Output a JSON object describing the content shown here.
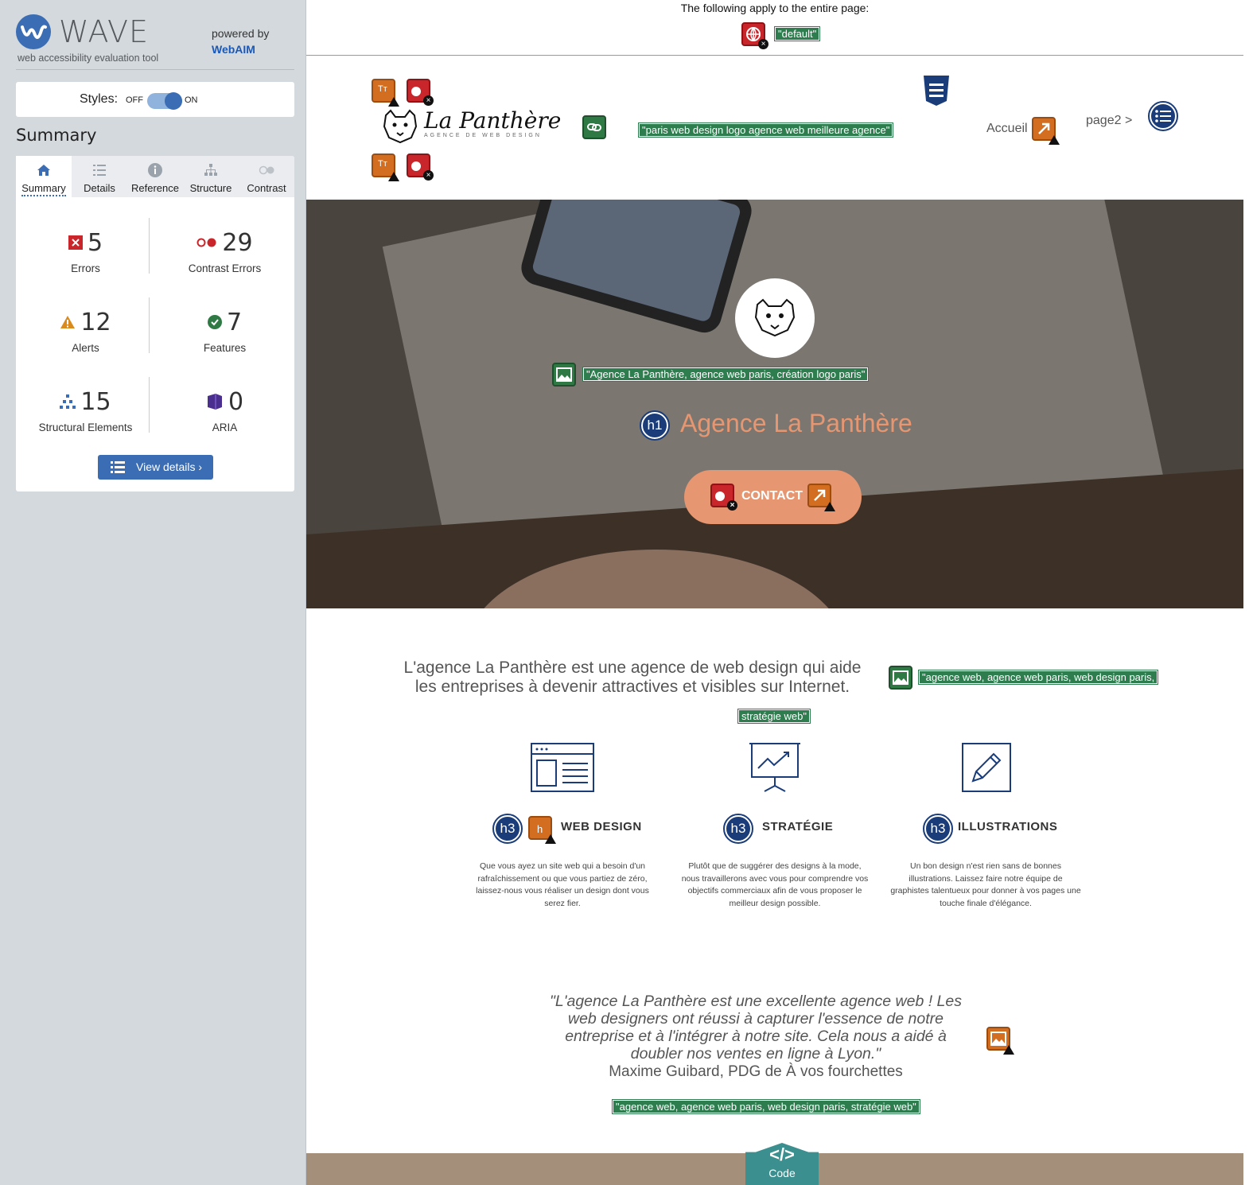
{
  "wave": {
    "name": "WAVE",
    "tagline": "web accessibility evaluation tool",
    "powered_by": "powered by",
    "powered_by_org": "WebAIM",
    "styles_label": "Styles:",
    "styles_off": "OFF",
    "styles_on": "ON",
    "styles_enabled": true,
    "summary_heading": "Summary",
    "tabs": [
      {
        "label": "Summary",
        "icon": "home-icon",
        "active": true
      },
      {
        "label": "Details",
        "icon": "list-icon",
        "active": false
      },
      {
        "label": "Reference",
        "icon": "info-icon",
        "active": false
      },
      {
        "label": "Structure",
        "icon": "structure-icon",
        "active": false
      },
      {
        "label": "Contrast",
        "icon": "contrast-icon",
        "active": false
      }
    ],
    "stats": {
      "errors": {
        "value": "5",
        "label": "Errors",
        "icon": "error-icon",
        "color": "#c8262a"
      },
      "contrast": {
        "value": "29",
        "label": "Contrast Errors",
        "icon": "contrast-error-icon",
        "color": "#c8262a"
      },
      "alerts": {
        "value": "12",
        "label": "Alerts",
        "icon": "alert-icon",
        "color": "#d98b1e"
      },
      "features": {
        "value": "7",
        "label": "Features",
        "icon": "feature-icon",
        "color": "#2f7a44"
      },
      "structural": {
        "value": "15",
        "label": "Structural Elements",
        "icon": "structure-icon",
        "color": "#3a6db3"
      },
      "aria": {
        "value": "0",
        "label": "ARIA",
        "icon": "aria-icon",
        "color": "#4a2f8f"
      }
    },
    "view_details": "View details ›"
  },
  "page": {
    "notice": "The following apply to the entire page:",
    "lang_tag": "\"default\"",
    "logo_title": "La Panthère",
    "logo_subtitle": "AGENCE DE WEB DESIGN",
    "logo_alt_tag": "\"paris web design logo agence web meilleure agence\"",
    "nav": {
      "home": "Accueil",
      "page2": "page2 >"
    },
    "hero_alt_tag": "\"Agence La Panthère, agence web paris, création logo paris\"",
    "hero_heading_level": "h1",
    "hero_title": "Agence La Panthère",
    "contact_label": "CONTACT",
    "intro_line1": "L'agence La Panthère est une agence de web design qui aide",
    "intro_line2": "les entreprises à devenir attractives et visibles sur Internet.",
    "intro_alt_tag_1": "\"agence web, agence web paris, web design paris,",
    "intro_alt_tag_2": "stratégie web\"",
    "services": [
      {
        "heading_level": "h3",
        "title": "WEB DESIGN",
        "icon": "browser-window-icon",
        "desc": "Que vous ayez un site web qui a besoin d'un rafraîchissement ou que vous partiez de zéro, laissez-nous vous réaliser un design dont vous serez fier."
      },
      {
        "heading_level": "h3",
        "title": "STRATÉGIE",
        "icon": "chart-board-icon",
        "desc": "Plutôt que de suggérer des designs à la mode, nous travaillerons avec vous pour comprendre vos objectifs commerciaux afin de vous proposer le meilleur design possible."
      },
      {
        "heading_level": "h3",
        "title": "ILLUSTRATIONS",
        "icon": "pencil-box-icon",
        "desc": "Un bon design n'est rien sans de bonnes illustrations. Laissez faire notre équipe de graphistes talentueux pour donner à vos pages une touche finale d'élégance."
      }
    ],
    "quote_line1": "\"L'agence La Panthère est une excellente agence web ! Les",
    "quote_line2": "web designers ont réussi à capturer l'essence de notre",
    "quote_line3": "entreprise et à l'intégrer à notre site. Cela nous a aidé à",
    "quote_line4": "doubler nos ventes en ligne à Lyon.\"",
    "quote_author": "Maxime Guibard, PDG de À vos fourchettes",
    "quote_alt_tag": "\"agence web, agence web paris, web design paris, stratégie web\"",
    "code_symbol": "</>",
    "code_label": "Code"
  },
  "colors": {
    "accent": "#3a6db3",
    "sidebar_bg": "#d4d9de",
    "hero_orange": "#e69670",
    "feature_green": "#2e7d4f",
    "code_teal": "#3c8f8f"
  }
}
